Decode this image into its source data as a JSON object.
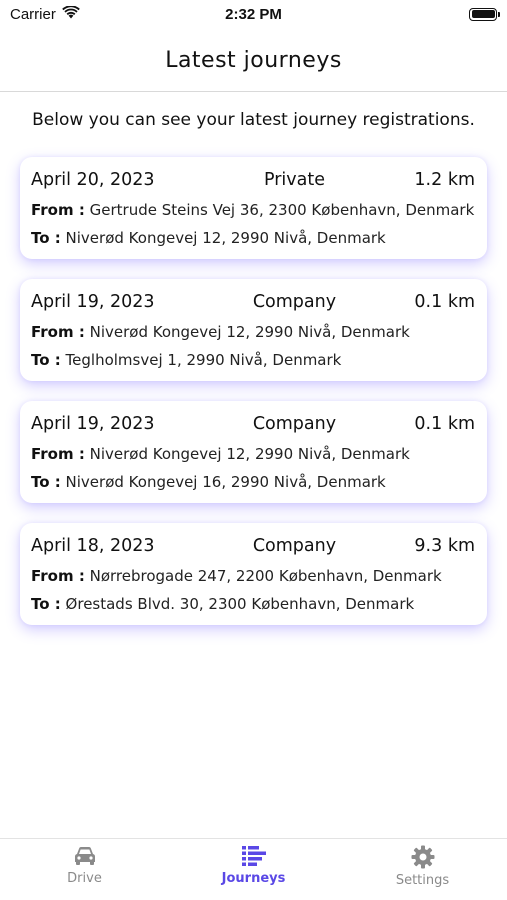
{
  "status_bar": {
    "carrier": "Carrier",
    "time": "2:32 PM"
  },
  "header": {
    "title": "Latest journeys"
  },
  "intro": "Below you can see your latest journey registrations.",
  "labels": {
    "from": "From :",
    "to": "To :"
  },
  "journeys": [
    {
      "date": "April 20, 2023",
      "type": "Private",
      "distance": "1.2 km",
      "from": "Gertrude Steins Vej 36, 2300 København, Denmark",
      "to": "Niverød Kongevej 12, 2990 Nivå, Denmark"
    },
    {
      "date": "April 19, 2023",
      "type": "Company",
      "distance": "0.1 km",
      "from": "Niverød Kongevej 12, 2990 Nivå, Denmark",
      "to": "Teglholmsvej 1, 2990 Nivå, Denmark"
    },
    {
      "date": "April 19, 2023",
      "type": "Company",
      "distance": "0.1 km",
      "from": "Niverød Kongevej 12, 2990 Nivå, Denmark",
      "to": "Niverød Kongevej 16, 2990 Nivå, Denmark"
    },
    {
      "date": "April 18, 2023",
      "type": "Company",
      "distance": "9.3 km",
      "from": "Nørrebrogade 247, 2200 København, Denmark",
      "to": "Ørestads Blvd. 30, 2300 København, Denmark"
    }
  ],
  "tabs": [
    {
      "label": "Drive",
      "icon": "car-icon",
      "active": false
    },
    {
      "label": "Journeys",
      "icon": "list-icon",
      "active": true
    },
    {
      "label": "Settings",
      "icon": "gear-icon",
      "active": false
    }
  ],
  "colors": {
    "accent": "#5a48e6",
    "inactive": "#8a8a8a",
    "card_shadow": "#6e5aff"
  }
}
